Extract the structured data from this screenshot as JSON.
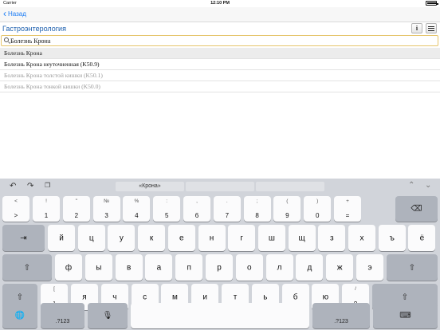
{
  "status": {
    "carrier": "Carrier",
    "time": "12:10 PM"
  },
  "nav": {
    "back_label": "Назад"
  },
  "header": {
    "title": "Гастроэнтерология"
  },
  "search": {
    "value": "Болезнь Крона",
    "placeholder": ""
  },
  "results": [
    {
      "text": "Болезнь Крона",
      "style": "header"
    },
    {
      "text": "Болезнь Крона неуточненная (K50.9)",
      "style": "normal"
    },
    {
      "text": "Болезнь Крона толстой кишки (K50.1)",
      "style": "dim"
    },
    {
      "text": "Болезнь Крона тонкой кишки (K50.0)",
      "style": "dim"
    }
  ],
  "keyboard": {
    "prediction": "«Крона»",
    "row1": [
      {
        "up": "!",
        "down": "1"
      },
      {
        "up": "\"",
        "down": "2"
      },
      {
        "up": "№",
        "down": "3"
      },
      {
        "up": "%",
        "down": "4"
      },
      {
        "up": ":",
        "down": "5"
      },
      {
        "up": ",",
        "down": "6"
      },
      {
        "up": ".",
        "down": "7"
      },
      {
        "up": ";",
        "down": "8"
      },
      {
        "up": "(",
        "down": "9"
      },
      {
        "up": ")",
        "down": "0"
      },
      {
        "up": "+",
        "down": "="
      }
    ],
    "first_key": {
      "up": "<",
      "down": ">"
    },
    "row2": [
      "й",
      "ц",
      "у",
      "к",
      "е",
      "н",
      "г",
      "ш",
      "щ",
      "з",
      "х",
      "ъ",
      "ё"
    ],
    "row3": [
      "ф",
      "ы",
      "в",
      "а",
      "п",
      "р",
      "о",
      "л",
      "д",
      "ж",
      "э"
    ],
    "row4": [
      "я",
      "ч",
      "с",
      "м",
      "и",
      "т",
      "ь",
      "б",
      "ю"
    ],
    "bracket_key": {
      "up": "[",
      "down": "]"
    },
    "slash_key": {
      "up": "/",
      "down": "?"
    },
    "num_label": ".?123"
  }
}
